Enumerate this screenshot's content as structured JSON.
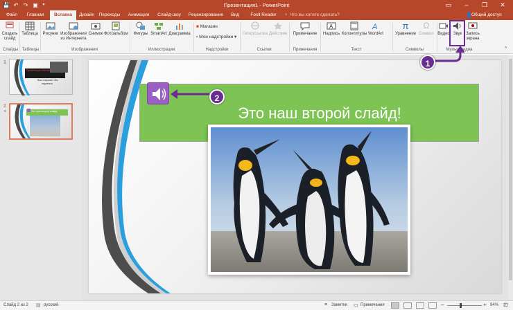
{
  "window": {
    "title": "Презентация1 - PowerPoint"
  },
  "tabs": [
    "Файл",
    "Главная",
    "Вставка",
    "Дизайн",
    "Переходы",
    "Анимация",
    "Слайд-шоу",
    "Рецензирование",
    "Вид",
    "Foxit Reader PDF"
  ],
  "active_tab_index": 2,
  "tell_me": "Что вы хотите сделать?",
  "share": "Общий доступ",
  "ribbon": {
    "buttons": [
      {
        "label": "Создать слайд",
        "icon": "new-slide-icon",
        "dim": false
      },
      {
        "label": "Таблица",
        "icon": "table-icon",
        "dim": false
      },
      {
        "label": "Рисунки",
        "icon": "pictures-icon",
        "dim": false
      },
      {
        "label": "Изображения из Интернета",
        "icon": "online-pictures-icon",
        "dim": false
      },
      {
        "label": "Снимок",
        "icon": "screenshot-icon",
        "dim": false
      },
      {
        "label": "Фотоальбом",
        "icon": "photo-album-icon",
        "dim": false
      },
      {
        "label": "Фигуры",
        "icon": "shapes-icon",
        "dim": false
      },
      {
        "label": "SmartArt",
        "icon": "smartart-icon",
        "dim": false
      },
      {
        "label": "Диаграмма",
        "icon": "chart-icon",
        "dim": false
      },
      {
        "label": "Магазин",
        "icon": "store-icon",
        "dim": false
      },
      {
        "label": "Мои надстройки",
        "icon": "my-addins-icon",
        "dim": false
      },
      {
        "label": "Гиперссылка",
        "icon": "hyperlink-icon",
        "dim": true
      },
      {
        "label": "Действие",
        "icon": "action-icon",
        "dim": true
      },
      {
        "label": "Примечание",
        "icon": "comment-icon",
        "dim": false
      },
      {
        "label": "Надпись",
        "icon": "textbox-icon",
        "dim": false
      },
      {
        "label": "Колонтитулы",
        "icon": "header-footer-icon",
        "dim": false
      },
      {
        "label": "WordArt",
        "icon": "wordart-icon",
        "dim": false
      },
      {
        "label": "Уравнение",
        "icon": "equation-icon",
        "dim": false
      },
      {
        "label": "Символ",
        "icon": "symbol-icon",
        "dim": true
      },
      {
        "label": "Видео",
        "icon": "video-icon",
        "dim": false
      },
      {
        "label": "Звук",
        "icon": "audio-icon",
        "dim": false
      },
      {
        "label": "Запись экрана",
        "icon": "screen-recording-icon",
        "dim": false
      }
    ],
    "groups": [
      "Слайды",
      "Таблицы",
      "Изображения",
      "Иллюстрации",
      "Надстройки",
      "Ссылки",
      "Примечания",
      "Текст",
      "Символы",
      "Мультимедиа"
    ]
  },
  "thumbnails": [
    {
      "number": "1",
      "lines": [
        "Презентация Microsoft",
        "Вам понравит. Мы",
        "надеемся"
      ]
    },
    {
      "number": "2",
      "lines": [
        "Это наш второй слайд!"
      ]
    }
  ],
  "slide": {
    "title": "Это наш второй слайд!"
  },
  "callouts": [
    "1",
    "2"
  ],
  "status": {
    "slide_info": "Слайд 2 из 2",
    "language": "русский",
    "notes": "Заметки",
    "comments": "Примечания",
    "zoom": "94%"
  },
  "colors": {
    "accent": "#b7472a",
    "green_band": "#7dc455",
    "speaker": "#9b5fc3",
    "callout": "#6a2c91"
  }
}
